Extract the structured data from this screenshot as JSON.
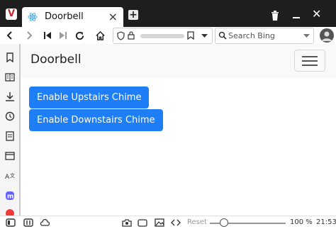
{
  "browser": {
    "tab": {
      "title": "Doorbell",
      "close": "×"
    },
    "new_tab_symbol": "+",
    "search": {
      "placeholder": "Search Bing"
    },
    "status": {
      "reset_label": "Reset",
      "zoom_level": "100 %",
      "zoom_fraction": 1.0,
      "clock": "21:53"
    },
    "icons": [
      "vivaldi-logo",
      "react-favicon",
      "close-icon",
      "new-tab-icon",
      "trash-icon",
      "minimize-icon",
      "window-close-icon",
      "back-icon",
      "forward-icon",
      "rewind-icon",
      "fast-forward-icon",
      "reload-icon",
      "home-icon",
      "shield-icon",
      "lock-icon",
      "bookmark-icon",
      "dropdown-icon",
      "search-icon",
      "profile-icon",
      "bookmarks-panel-icon",
      "reading-list-icon",
      "downloads-icon",
      "history-icon",
      "notes-icon",
      "window-panel-icon",
      "translate-icon",
      "mastodon-icon",
      "vivaldi-social-icon",
      "panel-toggle-icon",
      "tiling-icon",
      "sync-cloud-icon",
      "capture-icon",
      "window-icon",
      "image-icon",
      "code-icon"
    ]
  },
  "page": {
    "brand": "Doorbell",
    "buttons": {
      "upstairs": "Enable Upstairs Chime",
      "downstairs": "Enable Downstairs Chime"
    }
  },
  "colors": {
    "accent": "#1e7ef5",
    "tabbar": "#1e1e1e",
    "navbar": "#f8f9fa"
  }
}
